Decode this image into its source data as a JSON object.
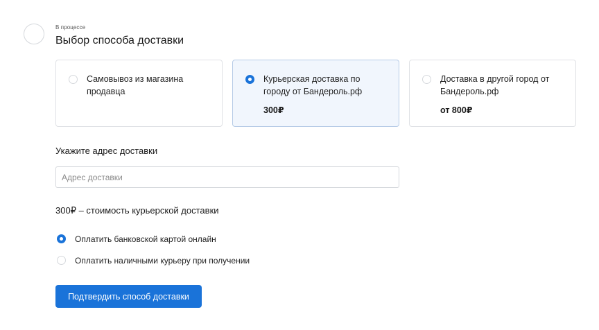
{
  "step": {
    "status": "В процессе",
    "title": "Выбор способа доставки"
  },
  "delivery_options": [
    {
      "label": "Самовывоз из магазина продавца",
      "price": "",
      "selected": false
    },
    {
      "label": "Курьерская доставка по городу от Бандероль.рф",
      "price": "300₽",
      "selected": true
    },
    {
      "label": "Доставка в другой город от Бандероль.рф",
      "price": "от 800₽",
      "selected": false
    }
  ],
  "address": {
    "heading": "Укажите адрес доставки",
    "placeholder": "Адрес доставки",
    "value": ""
  },
  "payment": {
    "heading": "300₽ – стоимость курьерской доставки",
    "options": [
      {
        "label": "Оплатить банковской картой онлайн",
        "selected": true
      },
      {
        "label": "Оплатить наличными курьеру при получении",
        "selected": false
      }
    ]
  },
  "confirm_button": {
    "label": "Подтвердить способ доставки"
  },
  "colors": {
    "accent": "#1a73d9",
    "selected_card_bg": "#f1f6fd",
    "border": "#dfe1e5"
  }
}
